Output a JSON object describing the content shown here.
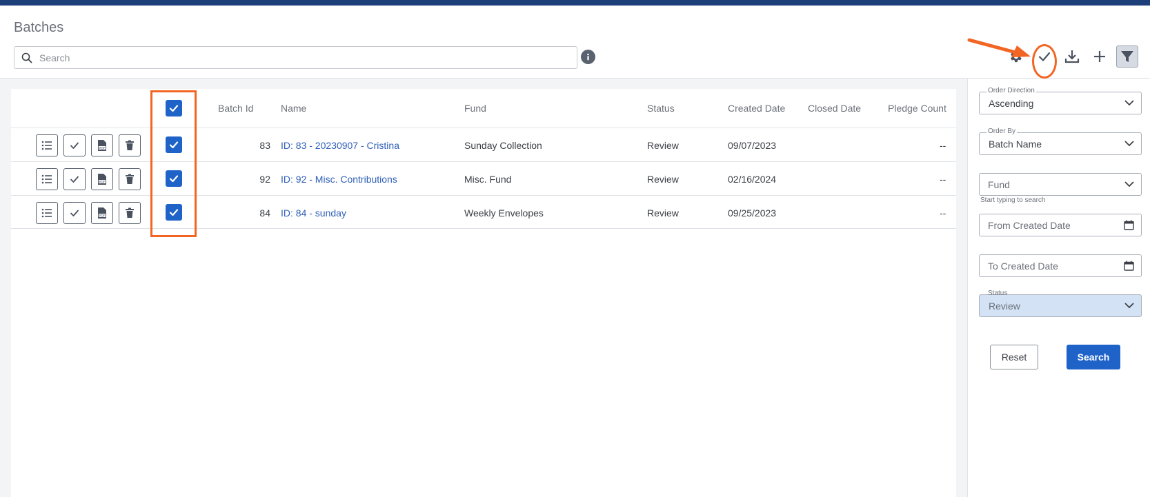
{
  "page": {
    "title": "Batches"
  },
  "search": {
    "placeholder": "Search"
  },
  "table": {
    "columns": [
      "Batch Id",
      "Name",
      "Fund",
      "Status",
      "Created Date",
      "Closed Date",
      "Pledge Count"
    ],
    "rows": [
      {
        "batch_id": "83",
        "name": "ID: 83 - 20230907 - Cristina",
        "fund": "Sunday Collection",
        "status": "Review",
        "created": "09/07/2023",
        "closed": "",
        "pledge": "--"
      },
      {
        "batch_id": "92",
        "name": "ID: 92 - Misc. Contributions",
        "fund": "Misc. Fund",
        "status": "Review",
        "created": "02/16/2024",
        "closed": "",
        "pledge": "--"
      },
      {
        "batch_id": "84",
        "name": "ID: 84 - sunday",
        "fund": "Weekly Envelopes",
        "status": "Review",
        "created": "09/25/2023",
        "closed": "",
        "pledge": "--"
      }
    ]
  },
  "filters": {
    "order_direction": {
      "label": "Order Direction",
      "value": "Ascending"
    },
    "order_by": {
      "label": "Order By",
      "value": "Batch Name"
    },
    "fund": {
      "placeholder": "Fund",
      "helper": "Start typing to search"
    },
    "from_created": {
      "placeholder": "From Created Date"
    },
    "to_created": {
      "placeholder": "To Created Date"
    },
    "status": {
      "label": "Status",
      "value": "Review"
    },
    "reset_label": "Reset",
    "search_label": "Search"
  },
  "colors": {
    "brand": "#1c3f7a",
    "accent": "#1f63c9",
    "highlight": "#f26522",
    "link": "#2f5fb8"
  },
  "icons": [
    "search-icon",
    "info-icon",
    "gear-icon",
    "check-icon",
    "download-icon",
    "plus-icon",
    "filter-icon",
    "list-icon",
    "pdf-icon",
    "trash-icon",
    "chevron-down-icon",
    "calendar-icon"
  ]
}
